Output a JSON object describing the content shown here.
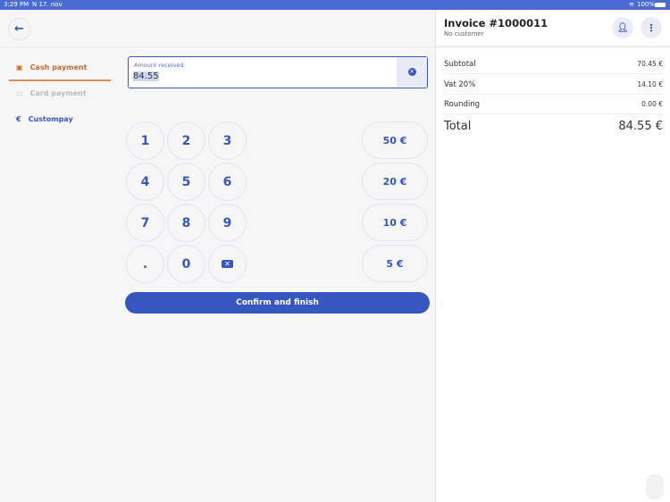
{
  "status": {
    "time": "3:29 PM",
    "date": "N 17. nov",
    "battery": "100%"
  },
  "sidebar": {
    "items": [
      {
        "label": "Cash payment"
      },
      {
        "label": "Card payment"
      },
      {
        "label": "Custompay"
      }
    ]
  },
  "input": {
    "label": "Amount received",
    "value": "84.55"
  },
  "keypad": [
    "1",
    "2",
    "3",
    "4",
    "5",
    "6",
    "7",
    "8",
    "9",
    ".",
    "0"
  ],
  "quick": [
    "50 €",
    "20 €",
    "10 €",
    "5 €"
  ],
  "confirm": "Confirm and finish",
  "invoice": {
    "title": "Invoice #1000011",
    "customer": "No customer",
    "rows": [
      {
        "label": "Subtotal",
        "value": "70.45 €"
      },
      {
        "label": "Vat 20%",
        "value": "14.10 €"
      },
      {
        "label": "Rounding",
        "value": "0.00 €"
      }
    ],
    "total_label": "Total",
    "total": "84.55 €"
  },
  "colors": {
    "accent": "#3a56b8",
    "cash": "#d0763a",
    "statusbar": "#4a6bd4"
  }
}
